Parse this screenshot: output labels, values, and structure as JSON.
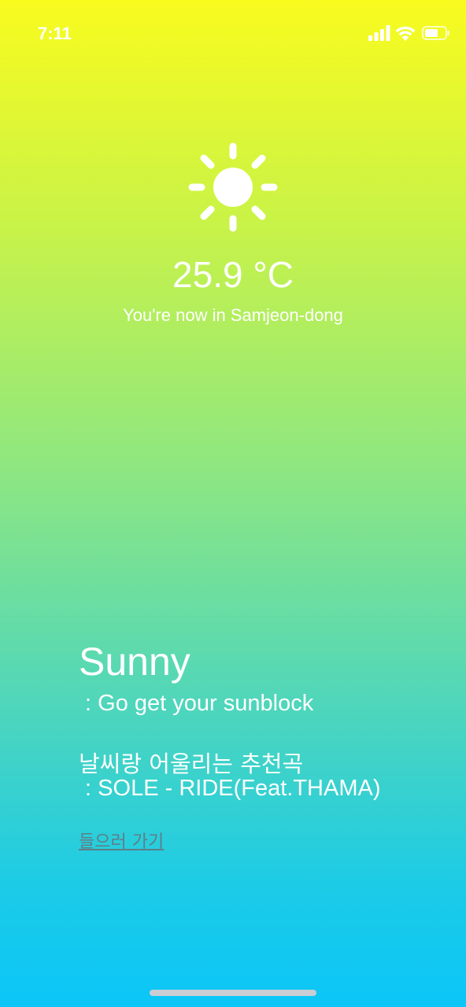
{
  "status_bar": {
    "time": "7:11",
    "icons": [
      "cellular-signal-icon",
      "wifi-icon",
      "battery-icon"
    ]
  },
  "weather": {
    "icon": "sun-icon",
    "temperature": "25.9 °C",
    "location": "You're now in Samjeon-dong",
    "condition": "Sunny",
    "condition_desc": " : Go get your sunblock"
  },
  "recommendation": {
    "heading": "날씨랑 어울리는 추천곡",
    "song": " : SOLE - RIDE(Feat.THAMA)",
    "listen_link": "들으러 가기"
  },
  "colors": {
    "gradient_top": "#f9fb1e",
    "gradient_bottom": "#0bc6f8",
    "text": "#ffffff",
    "link": "#5e7f88"
  }
}
